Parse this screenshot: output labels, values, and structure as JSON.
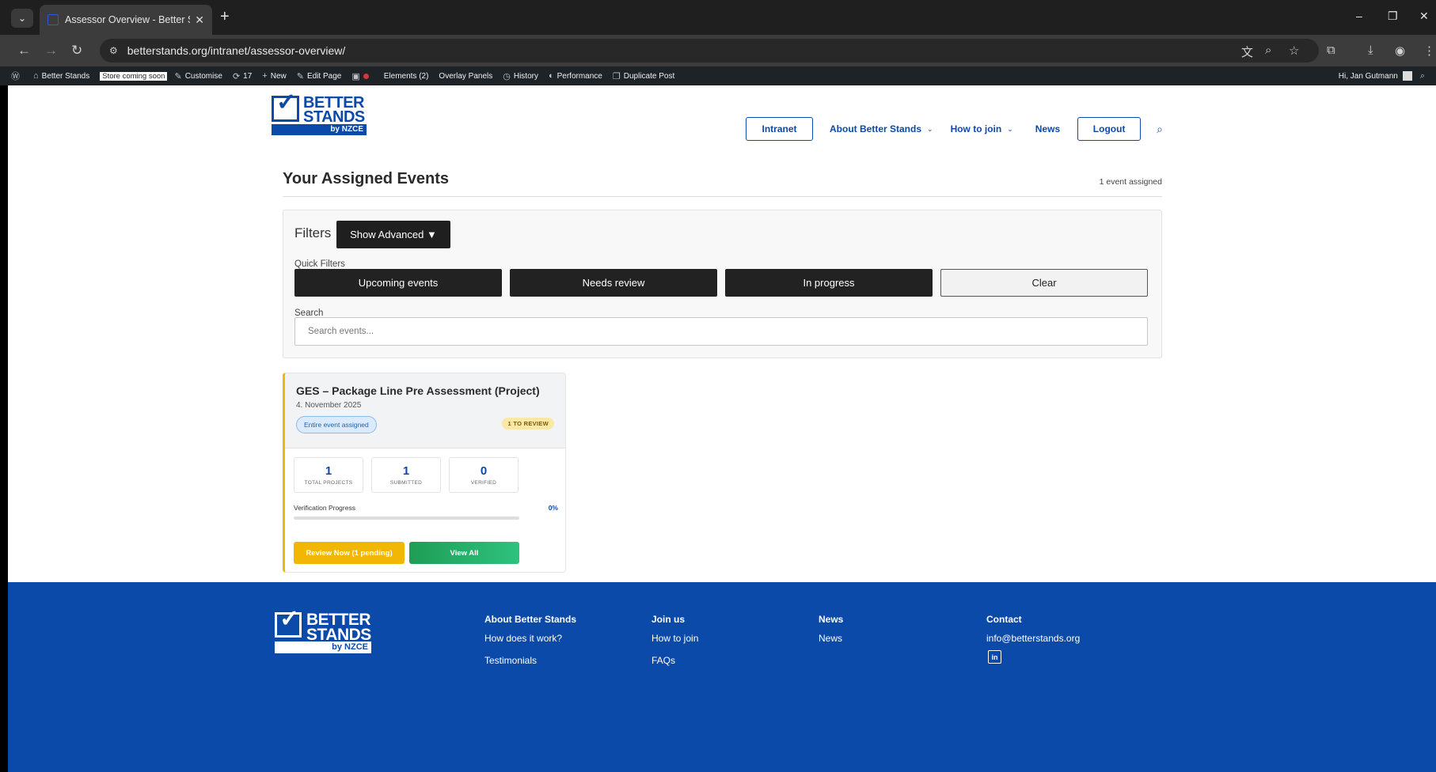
{
  "browser": {
    "tab_title": "Assessor Overview - Better Stan",
    "url": "betterstands.org/intranet/assessor-overview/"
  },
  "wpbar": {
    "site_name": "Better Stands",
    "store_badge": "Store coming soon",
    "customise": "Customise",
    "updates_count": "17",
    "new": "New",
    "edit_page": "Edit Page",
    "elements": "Elements (2)",
    "overlay_panels": "Overlay Panels",
    "history": "History",
    "performance": "Performance",
    "duplicate_post": "Duplicate Post",
    "greeting": "Hi, Jan Gutmann"
  },
  "logo": {
    "line1": "BETTER",
    "line2": "STANDS",
    "by": "by NZCE"
  },
  "nav": {
    "intranet": "Intranet",
    "about": "About Better Stands",
    "how_to_join": "How to join",
    "news": "News",
    "logout": "Logout"
  },
  "main": {
    "title": "Your Assigned Events",
    "count": "1 event assigned"
  },
  "filters": {
    "label": "Filters",
    "show_advanced": "Show Advanced ▼",
    "quick_filters_label": "Quick Filters",
    "quick": [
      "Upcoming events",
      "Needs review",
      "In progress",
      "Clear"
    ],
    "search_label": "Search",
    "search_placeholder": "Search events..."
  },
  "event_card": {
    "title": "GES – Package Line Pre Assessment (Project)",
    "date": "4. November 2025",
    "assignment_badge": "Entire event assigned",
    "review_badge": "1 TO REVIEW",
    "stats": [
      {
        "value": "1",
        "label": "TOTAL PROJECTS"
      },
      {
        "value": "1",
        "label": "SUBMITTED"
      },
      {
        "value": "0",
        "label": "VERIFIED"
      }
    ],
    "progress_label": "Verification Progress",
    "progress_percent_text": "0%",
    "progress_fraction": 0,
    "review_button": "Review Now (1 pending)",
    "view_all_button": "View All"
  },
  "footer": {
    "columns": [
      {
        "heading": "About Better Stands",
        "links": [
          "How does it work?",
          "Testimonials"
        ]
      },
      {
        "heading": "Join us",
        "links": [
          "How to join",
          "FAQs"
        ]
      },
      {
        "heading": "News",
        "links": [
          "News"
        ]
      },
      {
        "heading": "Contact",
        "links": [
          "info@betterstands.org"
        ]
      }
    ],
    "linkedin": "in"
  },
  "colors": {
    "brand_blue": "#0b4aa8",
    "accent_yellow": "#f2b705",
    "success_green": "#1f9d55"
  }
}
